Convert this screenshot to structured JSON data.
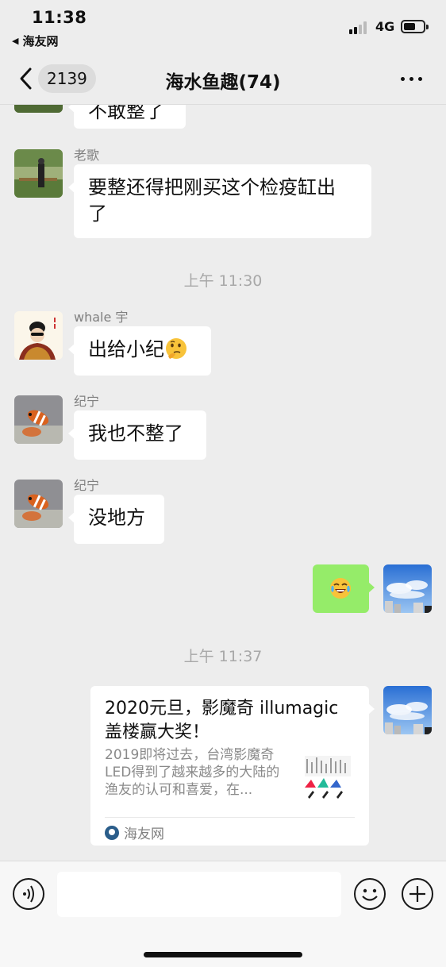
{
  "status_bar": {
    "time": "11:38",
    "back_app_label": "海友网",
    "network": "4G",
    "battery_level": 0.5
  },
  "nav": {
    "unread_count": "2139",
    "title": "海水鱼趣(74)"
  },
  "messages": {
    "m0_text": "不敢整了",
    "m1_sender": "老歌",
    "m1_text_line1": "要整还得把刚买这个检疫缸出",
    "m1_text_line2": "了",
    "ts1": "上午 11:30",
    "m2_sender": "whale 宇",
    "m2_text": "出给小纪",
    "m2_emoji": "thinking-face",
    "m3_sender": "纪宁",
    "m3_text": "我也不整了",
    "m4_sender": "纪宁",
    "m4_text": "没地方",
    "m5_emoji": "tears-of-joy",
    "ts2": "上午 11:37"
  },
  "link_card": {
    "title": "2020元旦，影魔奇 illumagic 盖楼赢大奖！",
    "description": "2019即将过去，台湾影魔奇LED得到了越来越多的大陆的渔友的认可和喜爱，在...",
    "source": "海友网"
  },
  "input_bar": {
    "voice_icon": "voice-icon",
    "emoji_icon": "smiley-icon",
    "plus_icon": "plus-icon"
  },
  "colors": {
    "background": "#ededed",
    "outgoing_bubble": "#95ec69",
    "incoming_bubble": "#ffffff"
  }
}
